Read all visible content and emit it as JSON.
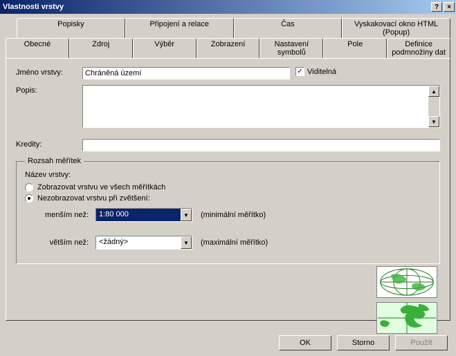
{
  "title": "Vlastnosti vrstvy",
  "titlebar_buttons": {
    "help": "?",
    "close": "×"
  },
  "tabs_row1": [
    {
      "label": "Popisky"
    },
    {
      "label": "Připojení a relace"
    },
    {
      "label": "Čas"
    },
    {
      "label": "Vyskakovací okno HTML (Popup)"
    }
  ],
  "tabs_row2": [
    {
      "label": "Obecné",
      "active": true
    },
    {
      "label": "Zdroj"
    },
    {
      "label": "Výběr"
    },
    {
      "label": "Zobrazení"
    },
    {
      "label": "Nastavení symbolů"
    },
    {
      "label": "Pole"
    },
    {
      "label": "Definice podmnožiny dat"
    }
  ],
  "labels": {
    "layer_name": "Jméno vrstvy:",
    "description": "Popis:",
    "credits": "Kredity:",
    "visible": "Viditelná"
  },
  "values": {
    "layer_name": "Chráněná území",
    "description": "",
    "credits": "",
    "visible_checked": true
  },
  "scale_group": {
    "legend": "Rozsah měřítek",
    "layer_name_label": "Název vrstvy:",
    "radio_all": "Zobrazovat vrstvu ve všech měřítkách",
    "radio_zoom": "Nezobrazovat vrstvu při zvětšení:",
    "radio_selected": "zoom",
    "min": {
      "label": "menším než:",
      "value": "1:80 000",
      "hint": "(minimální měřítko)"
    },
    "max": {
      "label": "větším než:",
      "value": "<žádný>",
      "hint": "(maximální měřítko)"
    }
  },
  "buttons": {
    "ok": "OK",
    "cancel": "Storno",
    "apply": "Použít"
  }
}
